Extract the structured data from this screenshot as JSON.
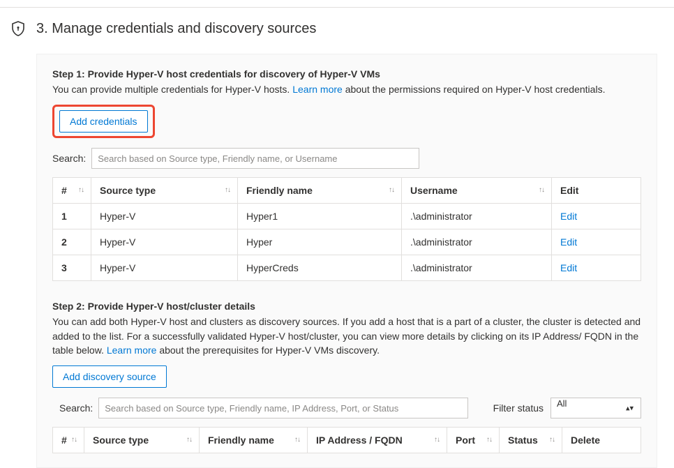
{
  "header": {
    "title": "3. Manage credentials and discovery sources"
  },
  "step1": {
    "heading": "Step 1: Provide Hyper-V host credentials for discovery of Hyper-V VMs",
    "desc_before": "You can provide multiple credentials for Hyper-V hosts. ",
    "learn_more": "Learn more",
    "desc_after": " about the permissions required on Hyper-V host credentials.",
    "add_btn": "Add credentials",
    "search_label": "Search:",
    "search_placeholder": "Search based on Source type, Friendly name, or Username",
    "columns": {
      "num": "#",
      "source": "Source type",
      "friendly": "Friendly name",
      "user": "Username",
      "edit": "Edit"
    },
    "rows": [
      {
        "num": "1",
        "source": "Hyper-V",
        "friendly": "Hyper1",
        "user": ".\\administrator",
        "edit": "Edit"
      },
      {
        "num": "2",
        "source": "Hyper-V",
        "friendly": "Hyper",
        "user": ".\\administrator",
        "edit": "Edit"
      },
      {
        "num": "3",
        "source": "Hyper-V",
        "friendly": "HyperCreds",
        "user": ".\\administrator",
        "edit": "Edit"
      }
    ]
  },
  "step2": {
    "heading": "Step 2: Provide Hyper-V host/cluster details",
    "desc_before": "You can add both Hyper-V host and clusters as discovery sources. If you add a host that is a part of a cluster, the cluster is detected and added to the list. For a successfully validated Hyper-V host/cluster, you can view more details by clicking on its IP Address/ FQDN in the table below. ",
    "learn_more": "Learn more",
    "desc_after": " about the prerequisites for Hyper-V VMs discovery.",
    "add_btn": "Add discovery source",
    "search_label": "Search:",
    "search_placeholder": "Search based on Source type, Friendly name, IP Address, Port, or Status",
    "filter_label": "Filter status",
    "filter_value": "All",
    "columns": {
      "num": "#",
      "source": "Source type",
      "friendly": "Friendly name",
      "ip": "IP Address / FQDN",
      "port": "Port",
      "status": "Status",
      "delete": "Delete"
    }
  }
}
